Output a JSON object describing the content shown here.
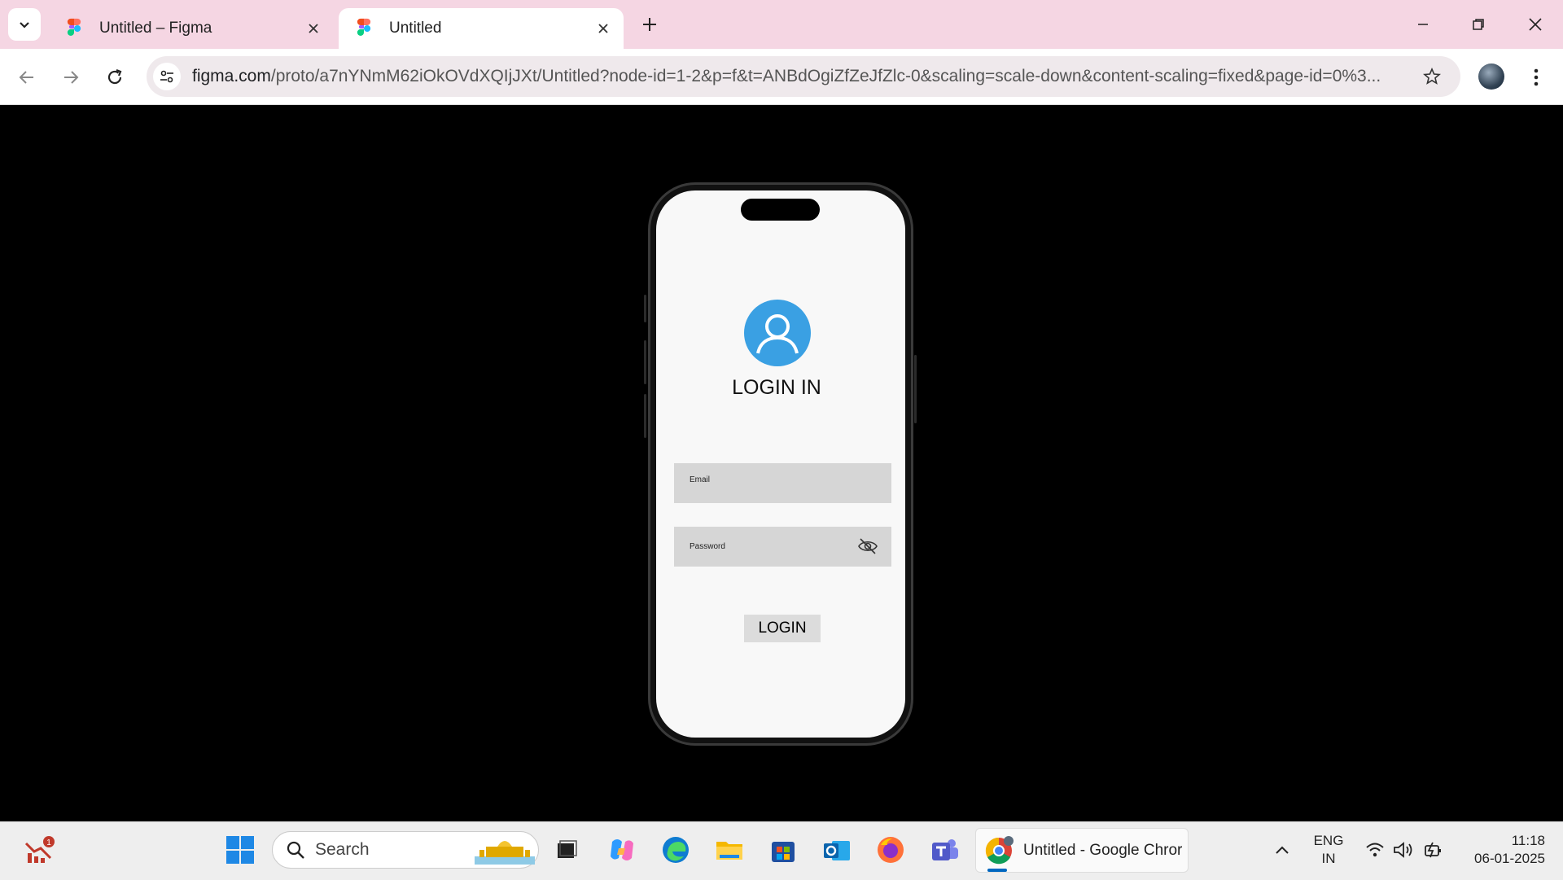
{
  "browser": {
    "tabs": [
      {
        "title": "Untitled – Figma",
        "active": false
      },
      {
        "title": "Untitled",
        "active": true
      }
    ],
    "url_host": "figma.com",
    "url_path": "/proto/a7nYNmM62iOkOVdXQIjJXt/Untitled?node-id=1-2&p=f&t=ANBdOgiZfZeJfZlc-0&scaling=scale-down&content-scaling=fixed&page-id=0%3..."
  },
  "app": {
    "title": "LOGIN IN",
    "email_placeholder": "Email",
    "password_placeholder": "Password",
    "login_button": "LOGIN"
  },
  "taskbar": {
    "search_label": "Search",
    "notification_count": "1",
    "chrome_window_label": "Untitled - Google Chror",
    "lang_line1": "ENG",
    "lang_line2": "IN",
    "time": "11:18",
    "date": "06-01-2025"
  },
  "colors": {
    "tabstrip_bg": "#f5d6e3",
    "avatar_blue": "#3aa0e3",
    "field_gray": "#d6d6d6"
  }
}
